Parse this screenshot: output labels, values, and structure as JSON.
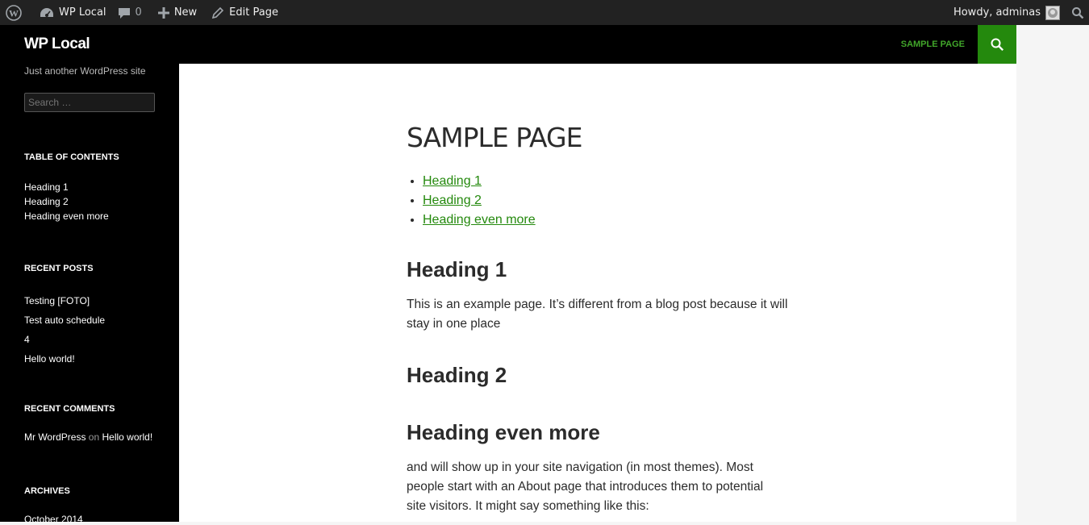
{
  "adminbar": {
    "wp_logo": "wordpress-logo-icon",
    "site_name": "WP Local",
    "comments_count": "0",
    "new_label": "New",
    "edit_label": "Edit Page",
    "howdy": "Howdy, adminas"
  },
  "site": {
    "title": "WP Local",
    "description": "Just another WordPress site",
    "search_placeholder": "Search …"
  },
  "nav": {
    "items": [
      "SAMPLE PAGE"
    ],
    "active_color": "#41a62a",
    "search_bg": "#24890d"
  },
  "widgets": {
    "toc": {
      "title": "TABLE OF CONTENTS",
      "items": [
        "Heading 1",
        "Heading 2",
        "Heading even more"
      ]
    },
    "recent_posts": {
      "title": "RECENT POSTS",
      "items": [
        "Testing [FOTO]",
        "Test auto schedule",
        "4",
        "Hello world!"
      ]
    },
    "recent_comments": {
      "title": "RECENT COMMENTS",
      "author": "Mr WordPress",
      "on": "on",
      "post": "Hello world!"
    },
    "archives": {
      "title": "ARCHIVES",
      "items": [
        "October 2014"
      ]
    }
  },
  "page": {
    "title": "SAMPLE PAGE",
    "toc_links": [
      "Heading 1",
      "Heading 2",
      "Heading even more"
    ],
    "sections": [
      {
        "heading": "Heading 1",
        "text": "This is an example page. It’s different from a blog post because it will stay in one place"
      },
      {
        "heading": "Heading 2",
        "text": ""
      },
      {
        "heading": "Heading even more",
        "text": "and will show up in your site navigation (in most themes). Most people start with an About page that introduces them to potential site visitors. It might say something like this:"
      }
    ]
  }
}
